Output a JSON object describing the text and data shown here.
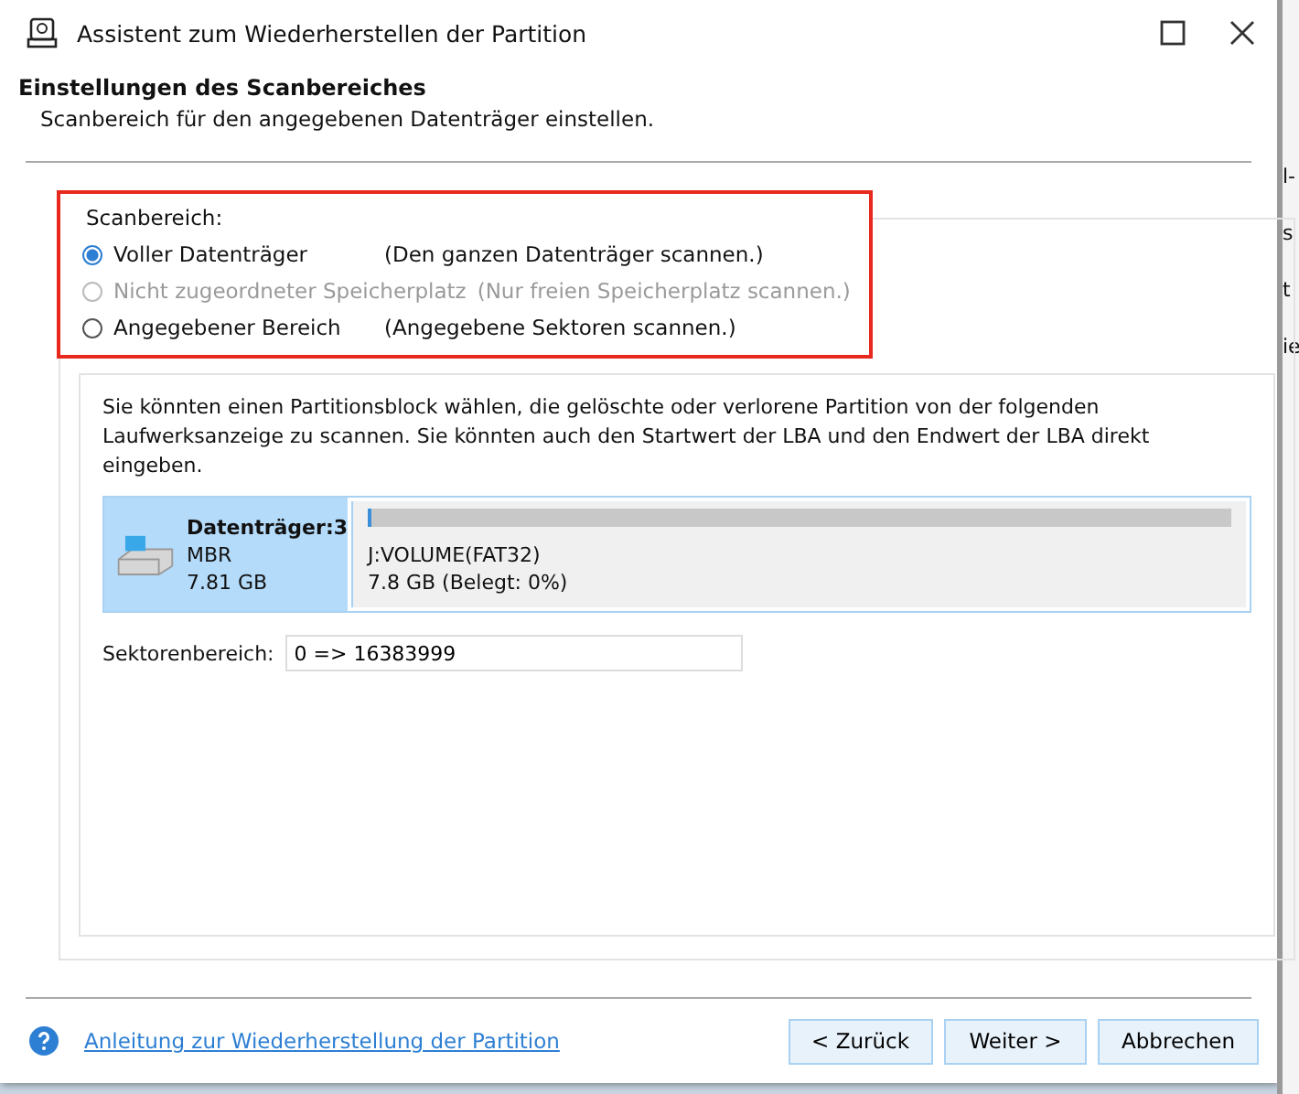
{
  "window": {
    "title": "Assistent zum Wiederherstellen der Partition"
  },
  "header": {
    "title": "Einstellungen des Scanbereiches",
    "subtitle": "Scanbereich für den angegebenen Datenträger einstellen."
  },
  "scan_range": {
    "legend": "Scanbereich:",
    "options": [
      {
        "label": "Voller Datenträger",
        "hint": "(Den ganzen Datenträger scannen.)",
        "selected": true,
        "disabled": false
      },
      {
        "label": "Nicht zugeordneter Speicherplatz",
        "hint": "(Nur freien Speicherplatz scannen.)",
        "selected": false,
        "disabled": true
      },
      {
        "label": "Angegebener Bereich",
        "hint": "(Angegebene Sektoren scannen.)",
        "selected": false,
        "disabled": false
      }
    ]
  },
  "description": "Sie könnten einen Partitionsblock wählen, die gelöschte oder verlorene Partition von der folgenden Laufwerksanzeige zu scannen. Sie könnten auch den Startwert der LBA und den Endwert der LBA direkt eingeben.",
  "disk": {
    "name": "Datenträger:3",
    "type": "MBR",
    "size": "7.81 GB",
    "selected": true,
    "partition": {
      "name": "J:VOLUME(FAT32)",
      "info": "7.8 GB (Belegt: 0%)",
      "level": 0.005
    }
  },
  "sector_range": {
    "label": "Sektorenbereich:",
    "value": "0 => 16383999"
  },
  "footer": {
    "help_link": "Anleitung zur Wiederherstellung der Partition",
    "buttons": [
      "< Zurück",
      "Weiter >",
      "Abbrechen"
    ]
  },
  "background_fragments": [
    "l-",
    "s",
    "t",
    "ie"
  ]
}
